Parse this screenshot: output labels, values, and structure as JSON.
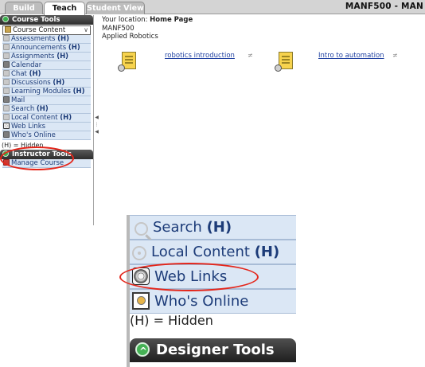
{
  "tabs": [
    {
      "label": "Build"
    },
    {
      "label": "Teach",
      "active": true
    },
    {
      "label": "Student View"
    }
  ],
  "course_title": "MANF500 - MAN",
  "sidebar": {
    "course_tools_header": "Course Tools",
    "course_content_select": "Course Content",
    "items": [
      {
        "label": "Assessments",
        "hidden_marker": "(H)",
        "icon": "assessments-icon"
      },
      {
        "label": "Announcements",
        "hidden_marker": "(H)",
        "icon": "announcements-icon"
      },
      {
        "label": "Assignments",
        "hidden_marker": "(H)",
        "icon": "assignments-icon"
      },
      {
        "label": "Calendar",
        "hidden_marker": "",
        "icon": "calendar-icon"
      },
      {
        "label": "Chat",
        "hidden_marker": "(H)",
        "icon": "chat-icon"
      },
      {
        "label": "Discussions",
        "hidden_marker": "(H)",
        "icon": "discussions-icon"
      },
      {
        "label": "Learning Modules",
        "hidden_marker": "(H)",
        "icon": "learning-modules-icon"
      },
      {
        "label": "Mail",
        "hidden_marker": "",
        "icon": "mail-icon"
      },
      {
        "label": "Search",
        "hidden_marker": "(H)",
        "icon": "search-icon"
      },
      {
        "label": "Local Content",
        "hidden_marker": "(H)",
        "icon": "local-content-icon"
      },
      {
        "label": "Web Links",
        "hidden_marker": "",
        "icon": "web-links-icon"
      },
      {
        "label": "Who's Online",
        "hidden_marker": "",
        "icon": "whos-online-icon"
      }
    ],
    "hidden_legend": "(H) = Hidden",
    "instructor_tools_header": "Instructor Tools",
    "instructor_items": [
      {
        "label": "Manage Course",
        "icon": "manage-course-icon"
      }
    ]
  },
  "content": {
    "location_prefix": "Your location:",
    "location_page": "Home Page",
    "course_code": "MANF500",
    "course_name": "Applied Robotics",
    "items": [
      {
        "label": "robotics introduction"
      },
      {
        "label": "Intro to automation"
      }
    ]
  },
  "zoom_inset": {
    "items": [
      {
        "label": "Search",
        "hidden_marker": "(H)",
        "icon": "search-icon"
      },
      {
        "label": "Local Content",
        "hidden_marker": "(H)",
        "icon": "local-content-icon"
      },
      {
        "label": "Web Links",
        "hidden_marker": "",
        "icon": "web-links-icon"
      },
      {
        "label": "Who's Online",
        "hidden_marker": "",
        "icon": "whos-online-icon"
      }
    ],
    "hidden_legend": "(H) = Hidden",
    "designer_tools_header": "Designer Tools"
  },
  "colors": {
    "nav_item_bg": "#dbe7f5",
    "link": "#1d3fa0",
    "highlight_ellipse": "#e4261b",
    "header_dark": "#2d2d2d"
  }
}
